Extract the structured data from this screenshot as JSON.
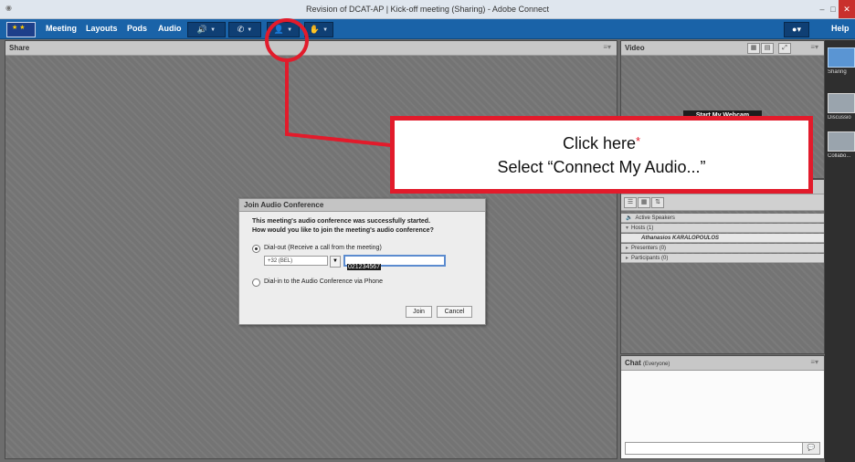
{
  "window": {
    "title": "Revision of DCAT-AP | Kick-off meeting (Sharing) - Adobe Connect",
    "controls": [
      "–",
      "□",
      "✕"
    ]
  },
  "menubar": {
    "items": [
      "Meeting",
      "Layouts",
      "Pods",
      "Audio"
    ],
    "help": "Help",
    "icons": [
      "speaker-icon",
      "phone-icon",
      "attendee-icon",
      "raise-hand-icon"
    ],
    "accent_color": "#1a63a8"
  },
  "share_pod": {
    "title": "Share"
  },
  "video_pod": {
    "title": "Video",
    "webcam_button": "Start My Webcam"
  },
  "attendee_pod": {
    "active_speakers": "Active Speakers",
    "hosts_label": "Hosts (1)",
    "host_name": "Athanasios KARALOPOULOS",
    "presenters_label": "Presenters (0)",
    "participants_label": "Participants (0)"
  },
  "chat_pod": {
    "title": "Chat",
    "scope": "(Everyone)"
  },
  "layouts_rail": {
    "items": [
      "Sharing",
      "Discussio",
      "Collabo..."
    ]
  },
  "dialog": {
    "title": "Join Audio Conference",
    "message_line1": "This meeting's audio conference was successfully started.",
    "message_line2": "How would you like to join the meeting's audio conference?",
    "option_dialout": "Dial-out (Receive a call from the meeting)",
    "country_code": "+32 (BEL)",
    "phone_number": "021234567",
    "option_dialin": "Dial-in to the Audio Conference via Phone",
    "join_button": "Join",
    "cancel_button": "Cancel"
  },
  "callout": {
    "line1": "Click here",
    "star": "*",
    "line2": "Select “Connect My Audio...”",
    "color": "#e21b2b"
  }
}
